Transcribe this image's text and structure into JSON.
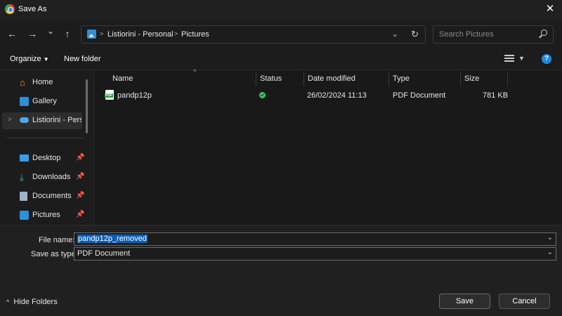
{
  "window": {
    "title": "Save As",
    "close_glyph": "✕"
  },
  "nav": {
    "back_glyph": "←",
    "forward_glyph": "→",
    "recent_glyph": "⌄",
    "up_glyph": "↑",
    "breadcrumb": [
      "Listiorini - Personal",
      "Pictures"
    ],
    "search_placeholder": "Search Pictures"
  },
  "toolbar": {
    "organize_label": "Organize",
    "new_folder_label": "New folder",
    "help_glyph": "?"
  },
  "sidebar": {
    "items": [
      {
        "label": "Home",
        "icon": "home-icon"
      },
      {
        "label": "Gallery",
        "icon": "gallery-icon"
      },
      {
        "label": "Listiorini - Personal",
        "icon": "onedrive-icon",
        "selected": true
      },
      {
        "label": "Desktop",
        "icon": "desktop-icon",
        "pinned": true
      },
      {
        "label": "Downloads",
        "icon": "download-icon",
        "pinned": true
      },
      {
        "label": "Documents",
        "icon": "documents-icon",
        "pinned": true
      },
      {
        "label": "Pictures",
        "icon": "pictures-icon",
        "pinned": true
      }
    ]
  },
  "columns": [
    "Name",
    "Status",
    "Date modified",
    "Type",
    "Size"
  ],
  "files": [
    {
      "name": "pandp12p",
      "status": "synced",
      "date_modified": "26/02/2024 11:13",
      "type": "PDF Document",
      "size": "781 KB"
    }
  ],
  "form": {
    "file_name_label": "File name:",
    "file_name_value": "pandp12p_removed",
    "save_type_label": "Save as type:",
    "save_type_value": "PDF Document"
  },
  "footer": {
    "hide_folders_label": "Hide Folders",
    "save_label": "Save",
    "cancel_label": "Cancel"
  },
  "colors": {
    "accent": "#0a5fb4",
    "status_ok": "#3ec46d",
    "help_blue": "#1e88e5"
  }
}
